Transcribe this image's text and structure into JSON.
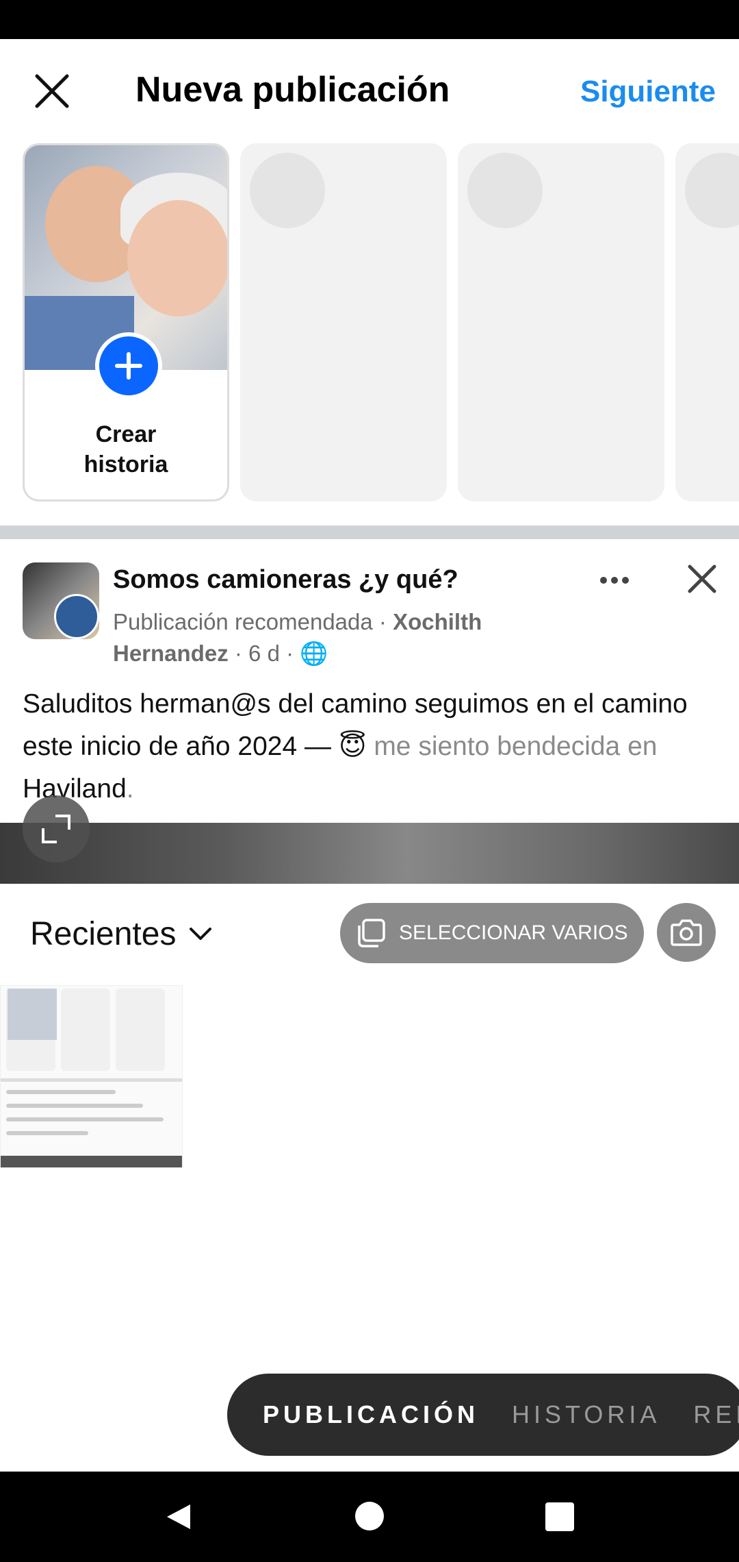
{
  "header": {
    "title": "Nueva publicación",
    "next_label": "Siguiente"
  },
  "stories": {
    "create_label_line1": "Crear",
    "create_label_line2": "historia"
  },
  "post": {
    "page_name": "Somos camioneras ¿y qué?",
    "meta_prefix": "Publicación recomendada · ",
    "author": "Xochilth Hernandez",
    "time": " · 6 d · ",
    "text_main": "Saluditos herman@s del camino seguimos en el camino este inicio de año 2024 — ",
    "emoji": "😇",
    "text_feeling": " me siento bendecida en ",
    "place": "Haviland",
    "text_end": "."
  },
  "gallery": {
    "album_label": "Recientes",
    "select_multiple_label": "SELECCIONAR VARIOS"
  },
  "modes": {
    "post": "PUBLICACIÓN",
    "story": "HISTORIA",
    "reel": "REEL"
  },
  "colors": {
    "accent": "#1a8cf0",
    "create_plus": "#0a66ff"
  }
}
